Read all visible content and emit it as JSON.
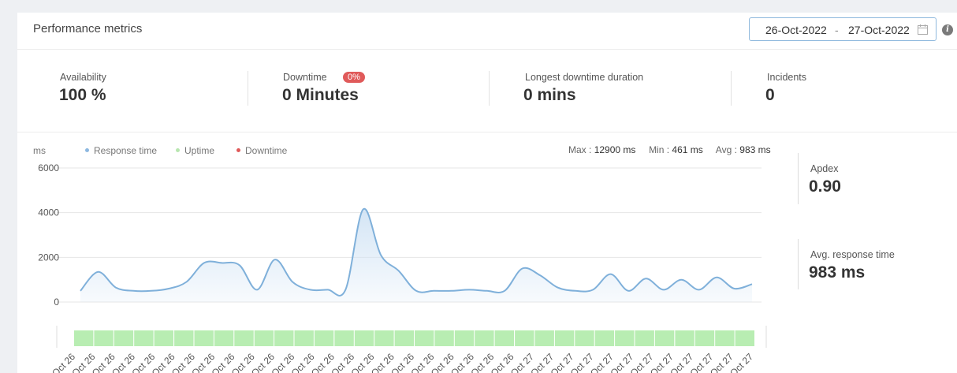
{
  "header": {
    "title": "Performance metrics",
    "date_from": "26-Oct-2022",
    "date_separator": "-",
    "date_to": "27-Oct-2022"
  },
  "stats": [
    {
      "label": "Availability",
      "value": "100 %"
    },
    {
      "label": "Downtime",
      "value": "0 Minutes",
      "badge": "0%"
    },
    {
      "label": "Longest downtime duration",
      "value": "0 mins"
    },
    {
      "label": "Incidents",
      "value": "0"
    }
  ],
  "legend": {
    "unit": "ms",
    "items": [
      {
        "label": "Response time",
        "color": "#8db8e0"
      },
      {
        "label": "Uptime",
        "color": "#b8e6b0"
      },
      {
        "label": "Downtime",
        "color": "#e05a5a"
      }
    ]
  },
  "summary": {
    "max_label": "Max :",
    "max_value": "12900 ms",
    "min_label": "Min :",
    "min_value": "461 ms",
    "avg_label": "Avg :",
    "avg_value": "983 ms"
  },
  "side": {
    "apdex_label": "Apdex",
    "apdex_value": "0.90",
    "avg_label": "Avg. response time",
    "avg_value": "983 ms"
  },
  "colors": {
    "line": "#7fb0da",
    "area_top": "#cfe2f4",
    "uptime": "#b8edb2",
    "grid": "#e6e6e6"
  },
  "chart_data": {
    "type": "area",
    "ylim": [
      0,
      6000
    ],
    "yticks": [
      "6000",
      "4000",
      "2000",
      "0"
    ],
    "ytick_values": [
      6000,
      4000,
      2000,
      0
    ],
    "x": [
      "Oct 26",
      "Oct 26",
      "Oct 26",
      "Oct 26",
      "Oct 26",
      "Oct 26",
      "Oct 26",
      "Oct 26",
      "Oct 26",
      "Oct 26",
      "Oct 26",
      "Oct 26",
      "Oct 26",
      "Oct 26",
      "Oct 26",
      "Oct 26",
      "Oct 26",
      "Oct 26",
      "Oct 26",
      "Oct 26",
      "Oct 26",
      "Oct 26",
      "Oct 26",
      "Oct 27",
      "Oct 27",
      "Oct 27",
      "Oct 27",
      "Oct 27",
      "Oct 27",
      "Oct 27",
      "Oct 27",
      "Oct 27",
      "Oct 27",
      "Oct 27",
      "Oct 27"
    ],
    "series": [
      {
        "name": "Response time",
        "values": [
          500,
          1350,
          650,
          500,
          500,
          600,
          900,
          1750,
          1750,
          1650,
          550,
          1900,
          900,
          550,
          550,
          550,
          4150,
          2100,
          1400,
          500,
          500,
          500,
          550,
          500,
          500,
          1500,
          1200,
          650,
          500,
          550,
          1250,
          500,
          1050,
          550,
          1000,
          550,
          1100,
          600,
          800
        ]
      }
    ],
    "uptime_blocks": 34
  }
}
